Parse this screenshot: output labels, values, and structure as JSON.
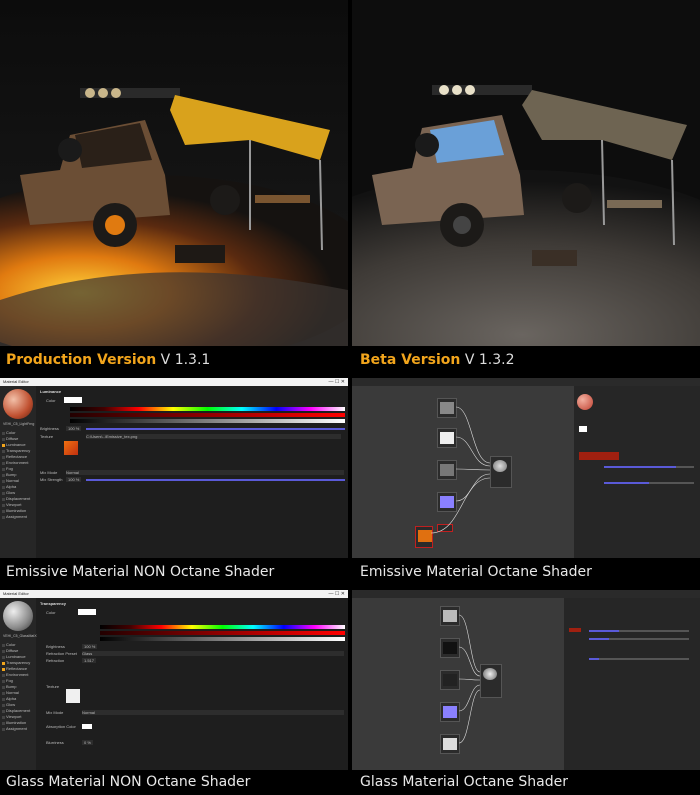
{
  "top_left": {
    "label_bold": "Production Version",
    "label_rest": " V 1.3.1"
  },
  "top_right": {
    "label_bold": "Beta Version",
    "label_rest": " V 1.3.2"
  },
  "row2_left": {
    "window_title": "Material Editor",
    "section": "Luminance",
    "color_label": "Color",
    "brightness_label": "Brightness",
    "brightness_value": "100 %",
    "texture_label": "Texture",
    "texture_path": "C:\\Users\\..\\Emissive_tex.png",
    "mix_mode_label": "Mix Mode",
    "mix_mode_value": "Normal",
    "mix_strength_label": "Mix Strength",
    "mix_strength_value": "100 %",
    "mat_name": "VEHI_C5_LightFrng",
    "channels": [
      "Color",
      "Diffuse",
      "Luminance",
      "Transparency",
      "Reflectance",
      "Environment",
      "Fog",
      "Bump",
      "Normal",
      "Alpha",
      "Glow",
      "Displacement",
      "Viewport",
      "Illumination",
      "Assignment"
    ],
    "channels_on": [
      false,
      false,
      true,
      false,
      false,
      false,
      false,
      false,
      false,
      false,
      false,
      false,
      false,
      false,
      false
    ],
    "caption": "Emissive Material NON Octane Shader"
  },
  "row2_right": {
    "caption": "Emissive Material Octane Shader"
  },
  "row3_left": {
    "window_title": "Material Editor",
    "section": "Transparency",
    "color_label": "Color",
    "brightness_label": "Brightness",
    "brightness_value": "100 %",
    "refraction_label": "Refraction Preset",
    "refraction_value": "Glass",
    "refraction_index_label": "Refraction",
    "refraction_index_value": "1.517",
    "texture_label": "Texture",
    "mat_name": "VEHI_C5_GlassMatX",
    "mix_mode_label": "Mix Mode",
    "mix_mode_value": "Normal",
    "absorption_label": "Absorption Color",
    "blurriness_label": "Blurriness",
    "blurriness_value": "0 %",
    "channels": [
      "Color",
      "Diffuse",
      "Luminance",
      "Transparency",
      "Reflectance",
      "Environment",
      "Fog",
      "Bump",
      "Normal",
      "Alpha",
      "Glow",
      "Displacement",
      "Viewport",
      "Illumination",
      "Assignment"
    ],
    "channels_on": [
      false,
      false,
      false,
      true,
      true,
      false,
      false,
      false,
      false,
      false,
      false,
      false,
      false,
      false,
      false
    ],
    "caption": "Glass Material NON Octane Shader"
  },
  "row3_right": {
    "caption": "Glass Material Octane Shader"
  }
}
